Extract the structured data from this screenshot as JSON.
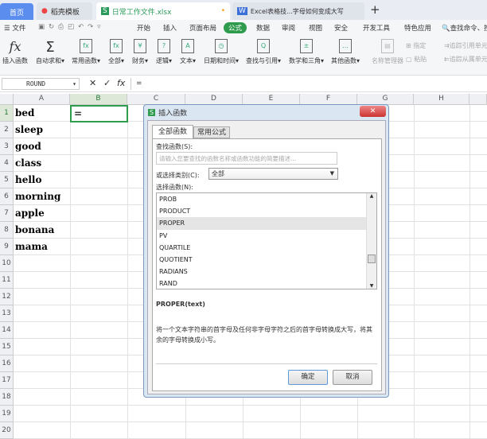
{
  "tabs": [
    {
      "label": "首页"
    },
    {
      "label": "稻壳模板"
    },
    {
      "label": "日常工作文件.xlsx"
    },
    {
      "label": "Excel表格技...字母如何变成大写"
    }
  ],
  "menu": {
    "file": "文件",
    "items": [
      "开始",
      "插入",
      "页面布局",
      "公式",
      "数据",
      "审阅",
      "视图",
      "安全",
      "开发工具",
      "特色应用"
    ],
    "active": "公式",
    "search": "查找命令、搜"
  },
  "ribbon": [
    {
      "label": "插入函数",
      "icon": "fx"
    },
    {
      "label": "自动求和",
      "icon": "Σ"
    },
    {
      "label": "常用函数",
      "icon": "fx"
    },
    {
      "label": "全部",
      "icon": "fx"
    },
    {
      "label": "财务",
      "icon": "¥"
    },
    {
      "label": "逻辑",
      "icon": "?"
    },
    {
      "label": "文本",
      "icon": "A"
    },
    {
      "label": "日期和时间",
      "icon": "◷"
    },
    {
      "label": "查找与引用",
      "icon": "Q"
    },
    {
      "label": "数学和三角",
      "icon": "±"
    },
    {
      "label": "其他函数",
      "icon": "…"
    },
    {
      "label": "名称管理器",
      "icon": "▤"
    }
  ],
  "ribbon_small": [
    "指定",
    "粘贴",
    "追踪引用单元格",
    "追踪从属单元格"
  ],
  "formula_bar": {
    "name_box": "ROUND",
    "formula": "="
  },
  "columns": [
    "A",
    "B",
    "C",
    "D",
    "E",
    "F",
    "G",
    "H"
  ],
  "rows": [
    "1",
    "2",
    "3",
    "4",
    "5",
    "6",
    "7",
    "8",
    "9",
    "10",
    "11",
    "12",
    "13",
    "14",
    "15",
    "16",
    "17",
    "18",
    "19",
    "20"
  ],
  "cells_a": [
    "bed",
    "sleep",
    "good",
    "class",
    "hello",
    "morning",
    "apple",
    "bonana",
    "mama"
  ],
  "cell_b1": "=",
  "dialog": {
    "title": "插入函数",
    "tabs": [
      "全部函数",
      "常用公式"
    ],
    "search_label": "查找函数(S):",
    "search_placeholder": "请输入您要查找的函数名称或函数功能的简要描述...",
    "category_label": "或选择类别(C):",
    "category": "全部",
    "select_label": "选择函数(N):",
    "functions": [
      "PROB",
      "PRODUCT",
      "PROPER",
      "PV",
      "QUARTILE",
      "QUOTIENT",
      "RADIANS",
      "RAND"
    ],
    "selected": "PROPER",
    "signature": "PROPER(text)",
    "description": "将一个文本字符串的首字母及任何非字母字符之后的首字母转换成大写，将其余的字母转换成小写。",
    "ok": "确定",
    "cancel": "取消"
  }
}
